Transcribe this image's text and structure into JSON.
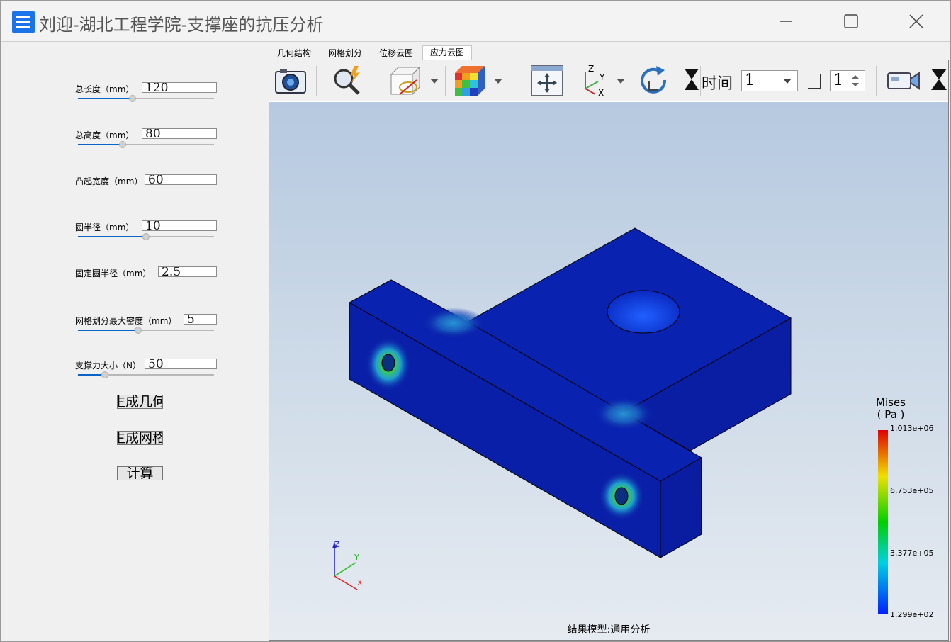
{
  "window": {
    "title": "刘迎-湖北工程学院-支撑座的抗压分析",
    "minimize_glyph": "—",
    "maximize_glyph": "☐",
    "close_glyph": "✕"
  },
  "params": [
    {
      "label": "总长度（mm）",
      "value": "120",
      "slider_fraction": 0.4
    },
    {
      "label": "总高度（mm）",
      "value": "80",
      "slider_fraction": 0.33
    },
    {
      "label": "凸起宽度（mm）",
      "value": "60"
    },
    {
      "label": "圆半径（mm）",
      "value": "10",
      "slider_fraction": 0.5
    },
    {
      "label": "固定圆半径（mm）",
      "value": "2.5"
    },
    {
      "label": "网格划分最大密度（mm）",
      "value": "5",
      "slider_fraction": 0.45
    },
    {
      "label": "支撑力大小（N）",
      "value": "50",
      "slider_fraction": 0.2
    }
  ],
  "buttons": {
    "gen_geometry": "生成几何",
    "gen_mesh": "生成网格",
    "compute": "计算"
  },
  "tabs": [
    "几何结构",
    "网格划分",
    "位移云图",
    "应力云图"
  ],
  "active_tab": "应力云图",
  "toolbar": {
    "time_label": "时间",
    "time_value": "1",
    "step_value": "1",
    "icons": [
      "camera-icon",
      "zoom-icon",
      "visibility-icon",
      "color-cube-icon",
      "fit-view-icon",
      "axes-icon",
      "rotate-icon",
      "video-icon"
    ]
  },
  "legend": {
    "title_line1": "Mises",
    "title_line2": "( Pa )",
    "max": "1.013e+06",
    "v2": "6.753e+05",
    "v3": "3.377e+05",
    "min": "1.299e+02"
  },
  "axis_labels": {
    "z": "Z",
    "y": "Y",
    "x": "X"
  },
  "model_label": "结果模型:通用分析",
  "colors": {
    "accent": "#0a64c8",
    "mesh_base": "#0a1fa8"
  }
}
